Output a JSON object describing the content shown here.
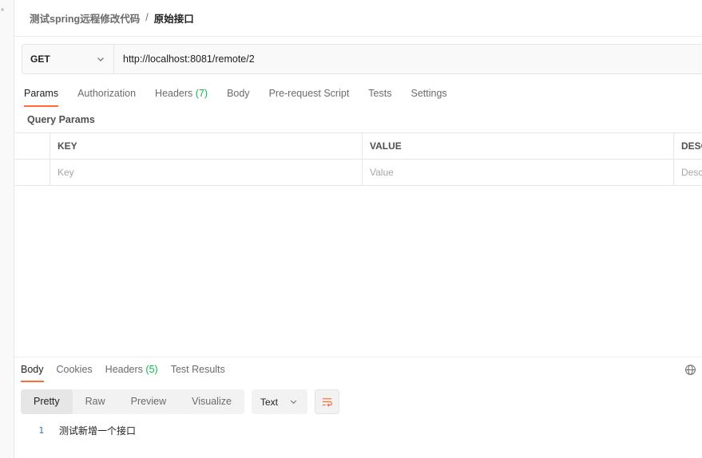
{
  "sidebar": {
    "glyph": "°"
  },
  "breadcrumb": {
    "parent": "测试spring远程修改代码",
    "separator": "/",
    "current": "原始接口"
  },
  "request": {
    "method": "GET",
    "url": "http://localhost:8081/remote/2"
  },
  "request_tabs": [
    {
      "label": "Params",
      "count": ""
    },
    {
      "label": "Authorization",
      "count": ""
    },
    {
      "label": "Headers",
      "count": "(7)"
    },
    {
      "label": "Body",
      "count": ""
    },
    {
      "label": "Pre-request Script",
      "count": ""
    },
    {
      "label": "Tests",
      "count": ""
    },
    {
      "label": "Settings",
      "count": ""
    }
  ],
  "query_params": {
    "title": "Query Params",
    "columns": {
      "key": "KEY",
      "value": "VALUE",
      "description": "DESCRIPTION"
    },
    "placeholders": {
      "key": "Key",
      "value": "Value",
      "description": "Description"
    }
  },
  "response_tabs": [
    {
      "label": "Body",
      "count": ""
    },
    {
      "label": "Cookies",
      "count": ""
    },
    {
      "label": "Headers",
      "count": "(5)"
    },
    {
      "label": "Test Results",
      "count": ""
    }
  ],
  "format_buttons": [
    "Pretty",
    "Raw",
    "Preview",
    "Visualize"
  ],
  "response_type": "Text",
  "response_body": [
    {
      "line": "1",
      "text": "测试新增一个接口"
    }
  ],
  "colors": {
    "accent": "#ff6c37",
    "count_green": "#0cbb52",
    "line_number": "#2f72c4"
  },
  "icons": {
    "method_dropdown": "chevron-down-icon",
    "type_dropdown": "chevron-down-icon",
    "wrap": "wrap-lines-icon",
    "network": "globe-icon"
  }
}
